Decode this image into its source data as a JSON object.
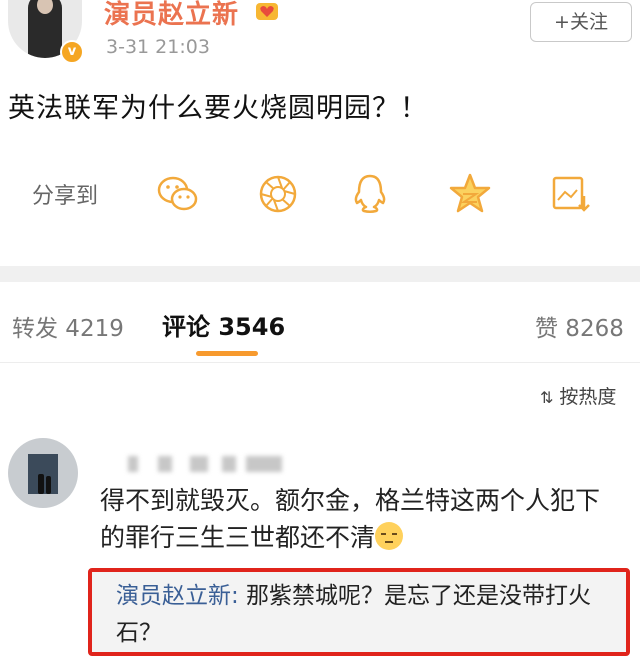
{
  "header": {
    "username": "演员赵立新",
    "time": "3-31 21:03",
    "follow_label": "+关注",
    "verified_mark": "v"
  },
  "post": {
    "text": "英法联军为什么要火烧圆明园？！"
  },
  "share": {
    "label": "分享到",
    "icons": [
      "wechat-icon",
      "moments-icon",
      "qq-icon",
      "qzone-icon",
      "save-image-icon"
    ]
  },
  "tabs": {
    "repost": "转发 4219",
    "comment": "评论 3546",
    "like": "赞 8268"
  },
  "sort": {
    "label": "按热度"
  },
  "comment": {
    "text": "得不到就毁灭。额尔金，格兰特这两个人犯下的罪行三生三世都还不清"
  },
  "reply": {
    "name": "演员赵立新:",
    "text": " 那紫禁城呢？是忘了还是没带打火石？"
  },
  "colors": {
    "username": "#eb7350",
    "accent_underline": "#f79a2e",
    "highlight_border": "#e0241b",
    "share_icon": "#f2a93b"
  }
}
